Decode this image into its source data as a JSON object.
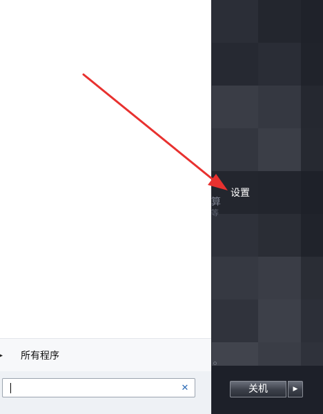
{
  "start_menu": {
    "all_programs_label": "所有程序",
    "search": {
      "value": "",
      "clear_icon": "close-icon"
    }
  },
  "right_pane": {
    "settings_label": "设置",
    "faded_text_1": "算",
    "faded_text_2": "等"
  },
  "shutdown": {
    "label": "关机",
    "more_icon": "triangle-right-icon"
  },
  "annotation": {
    "arrow_color": "#e8312f"
  },
  "colors": {
    "taskbar_bg": "#1d2029",
    "menu_bg": "#ffffff"
  }
}
